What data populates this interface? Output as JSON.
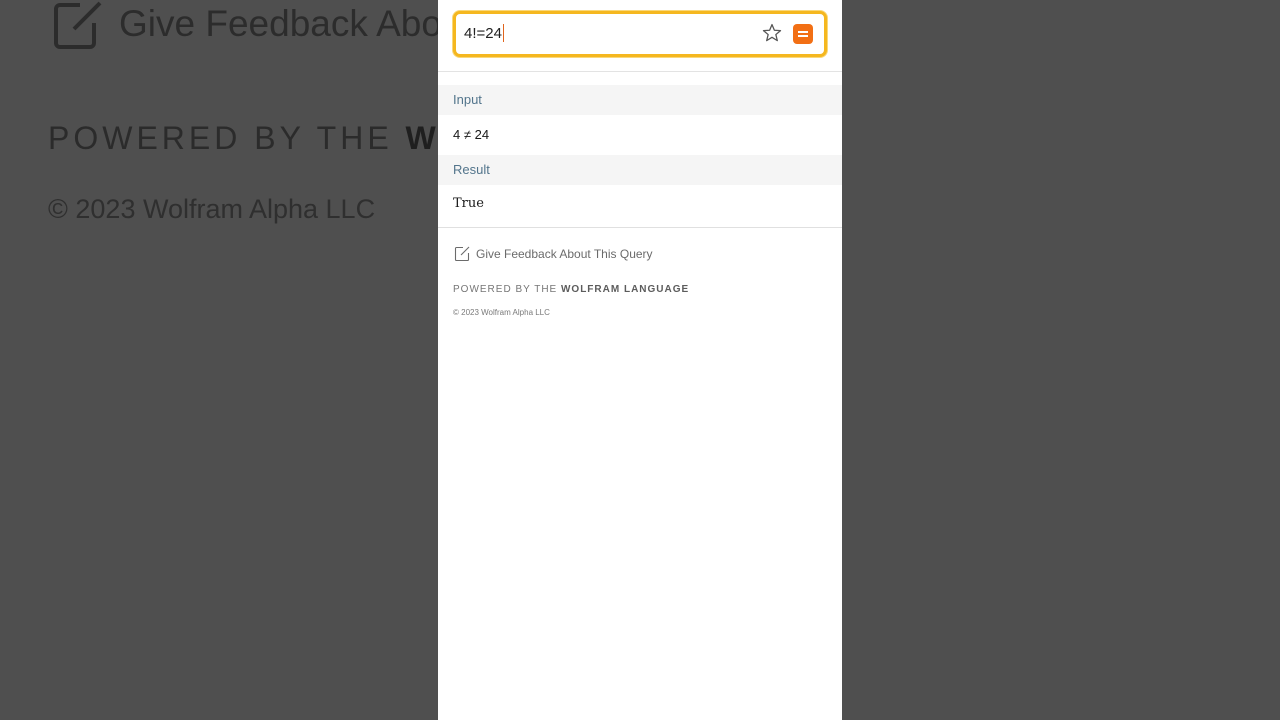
{
  "background": {
    "feedback_label": "Give Feedback Abo",
    "powered_prefix": "POWERED BY THE ",
    "powered_brand": "WO",
    "copyright": "© 2023 Wolfram Alpha LLC"
  },
  "search": {
    "query": "4!=24",
    "star_icon": "star-icon",
    "go_icon": "equals-icon"
  },
  "pods": [
    {
      "title": "Input",
      "content": "4 ≠ 24"
    },
    {
      "title": "Result",
      "content": "True"
    }
  ],
  "footer": {
    "feedback_label": "Give Feedback About This Query",
    "powered_prefix": "POWERED BY THE ",
    "powered_brand": "WOLFRAM LANGUAGE",
    "copyright": "© 2023 Wolfram Alpha LLC"
  },
  "colors": {
    "accent_orange": "#f26f14",
    "search_border": "#f5b71f",
    "pod_title": "#53758c"
  }
}
